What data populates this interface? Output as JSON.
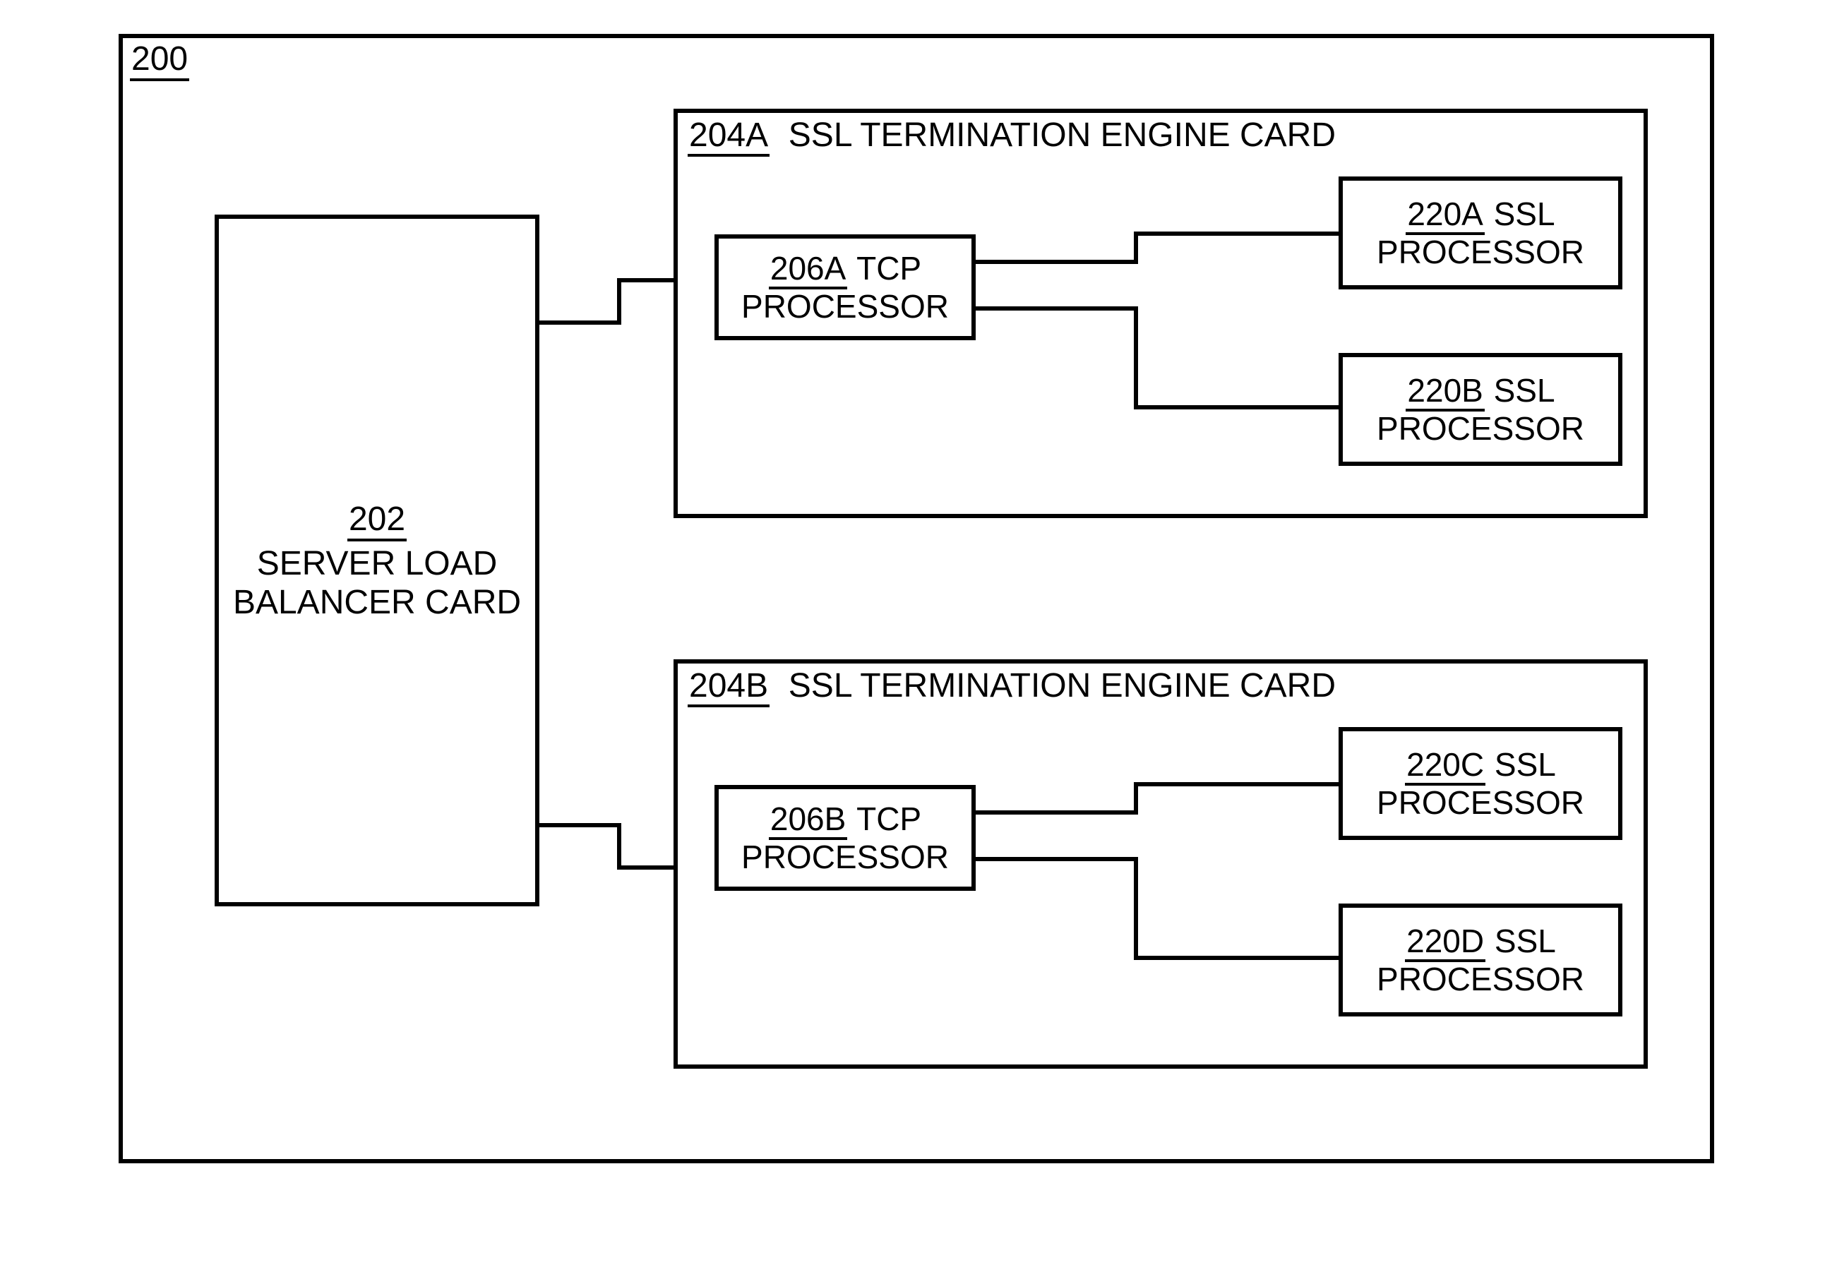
{
  "figure_number": "200",
  "slb": {
    "ref": "202",
    "line1": "SERVER LOAD",
    "line2": "BALANCER CARD"
  },
  "cards": {
    "a": {
      "ref": "204A",
      "title": "SSL TERMINATION ENGINE CARD",
      "tcp": {
        "ref": "206A",
        "label_top": "TCP",
        "label_bottom": "PROCESSOR"
      },
      "ssl_upper": {
        "ref": "220A",
        "label_top": "SSL",
        "label_bottom": "PROCESSOR"
      },
      "ssl_lower": {
        "ref": "220B",
        "label_top": "SSL",
        "label_bottom": "PROCESSOR"
      }
    },
    "b": {
      "ref": "204B",
      "title": "SSL TERMINATION ENGINE CARD",
      "tcp": {
        "ref": "206B",
        "label_top": "TCP",
        "label_bottom": "PROCESSOR"
      },
      "ssl_upper": {
        "ref": "220C",
        "label_top": "SSL",
        "label_bottom": "PROCESSOR"
      },
      "ssl_lower": {
        "ref": "220D",
        "label_top": "SSL",
        "label_bottom": "PROCESSOR"
      }
    }
  }
}
